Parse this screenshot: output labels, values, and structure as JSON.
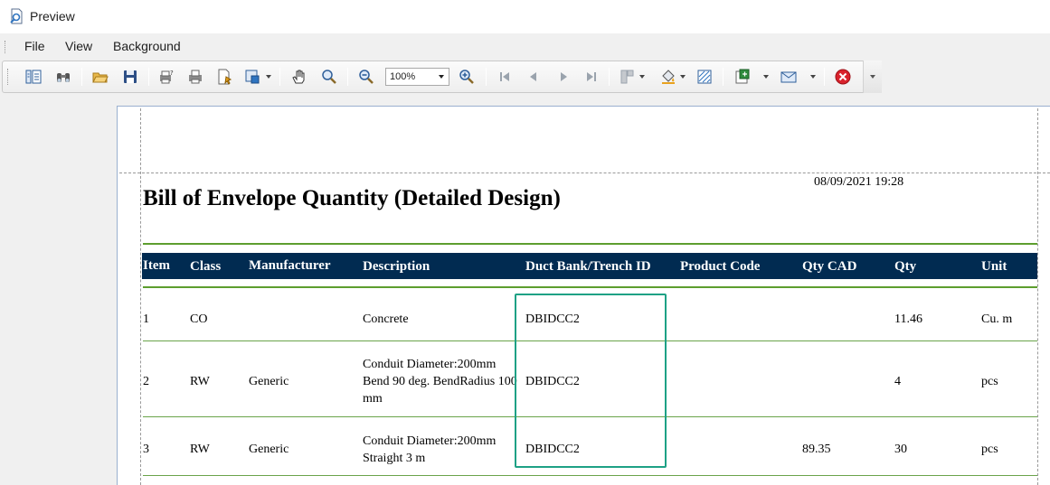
{
  "window": {
    "title": "Preview"
  },
  "menu": {
    "items": [
      "File",
      "View",
      "Background"
    ]
  },
  "toolbar": {
    "zoom_value": "100%",
    "icons": [
      "document-map-icon",
      "find-icon",
      "open-icon",
      "save-icon",
      "page-setup-icon",
      "print-icon",
      "quick-print-icon",
      "scale-icon",
      "hand-tool-icon",
      "magnifier-icon",
      "zoom-out-icon",
      "zoom-in-icon",
      "first-page-icon",
      "previous-page-icon",
      "next-page-icon",
      "last-page-icon",
      "multiple-pages-icon",
      "color-fill-icon",
      "watermark-icon",
      "export-icon",
      "send-email-icon",
      "close-preview-icon"
    ]
  },
  "report": {
    "title": "Bill of Envelope Quantity (Detailed Design)",
    "date": "08/09/2021 19:28",
    "columns": [
      "Item",
      "Class",
      "Manufacturer",
      "Description",
      "Duct Bank/Trench ID",
      "Product Code",
      "Qty CAD",
      "Qty",
      "Unit"
    ],
    "rows": [
      {
        "item": "1",
        "class": "CO",
        "manufacturer": "",
        "description": "Concrete",
        "duct_bank_id": "DBIDCC2",
        "product_code": "",
        "qty_cad": "",
        "qty": "11.46",
        "unit": "Cu. m"
      },
      {
        "item": "2",
        "class": "RW",
        "manufacturer": "Generic",
        "description": "Conduit Diameter:200mm Bend 90 deg. BendRadius 100 mm",
        "duct_bank_id": "DBIDCC2",
        "product_code": "",
        "qty_cad": "",
        "qty": "4",
        "unit": "pcs"
      },
      {
        "item": "3",
        "class": "RW",
        "manufacturer": "Generic",
        "description": "Conduit Diameter:200mm Straight 3 m",
        "duct_bank_id": "DBIDCC2",
        "product_code": "",
        "qty_cad": "89.35",
        "qty": "30",
        "unit": "pcs"
      }
    ]
  },
  "colors": {
    "header_fill": "#012b51",
    "rule_green": "#5d9e2e",
    "highlight": "#1ea185",
    "close_red": "#d9232d"
  }
}
